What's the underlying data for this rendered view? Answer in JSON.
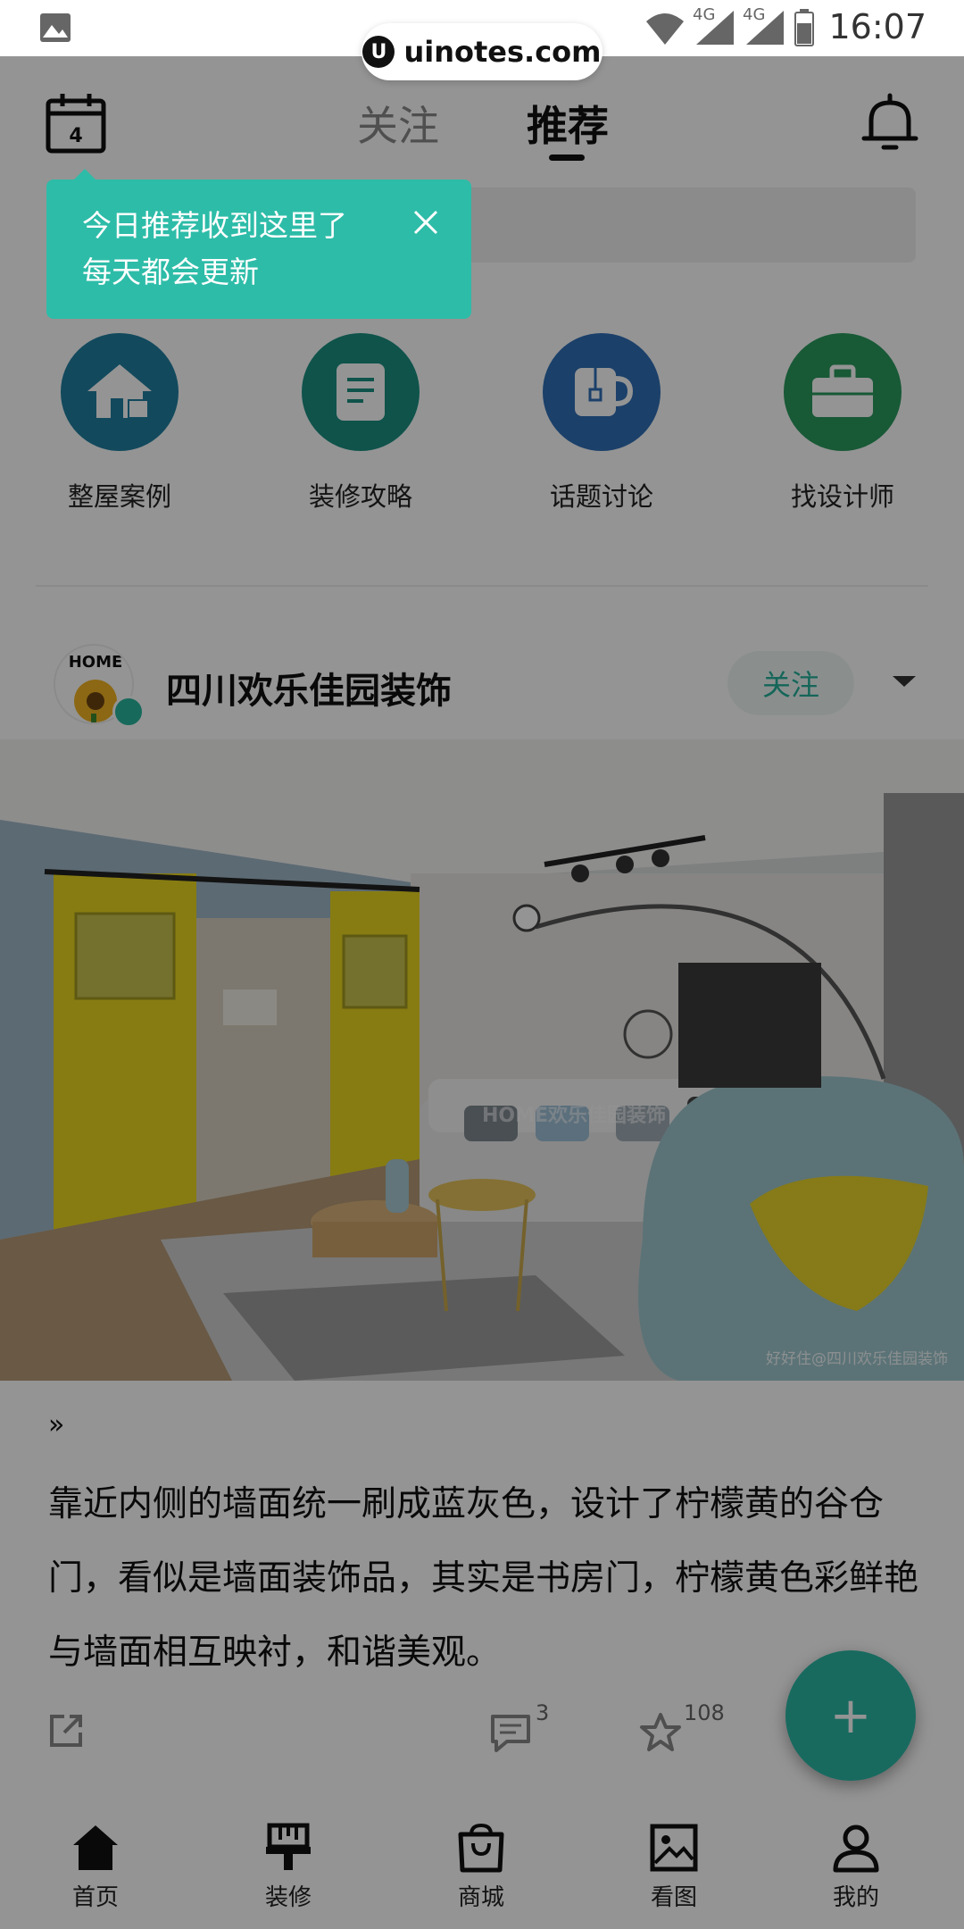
{
  "status_bar": {
    "time": "16:07",
    "network_1": "4G",
    "network_2": "4G"
  },
  "watermark": {
    "text": "uinotes.com"
  },
  "header": {
    "calendar_day": "4",
    "tabs": [
      {
        "label": "关注",
        "active": false
      },
      {
        "label": "推荐",
        "active": true
      }
    ]
  },
  "tooltip": {
    "line1": "今日推荐收到这里了",
    "line2": "每天都会更新"
  },
  "categories": [
    {
      "label": "整屋案例",
      "color": "#1f7fa0",
      "icon": "house-icon"
    },
    {
      "label": "装修攻略",
      "color": "#1a9081",
      "icon": "document-icon"
    },
    {
      "label": "话题讨论",
      "color": "#2f6fb7",
      "icon": "cup-icon"
    },
    {
      "label": "找设计师",
      "color": "#2a9a5e",
      "icon": "briefcase-icon"
    }
  ],
  "post": {
    "author": "四川欢乐佳园装饰",
    "avatar_text": "HOME",
    "follow_label": "关注",
    "photo_credit": "好好住@四川欢乐佳园装饰",
    "photo_watermark": "HOME欢乐佳园装饰",
    "quote_mark": "»",
    "text": "靠近内侧的墙面统一刷成蓝灰色，设计了柠檬黄的谷仓门，看似是墙面装饰品，其实是书房门，柠檬黄色彩鲜艳与墙面相互映衬，和谐美观。",
    "comment_count": "3",
    "star_count": "108"
  },
  "fab": {
    "label": "+"
  },
  "bottom_nav": [
    {
      "label": "首页",
      "icon": "home-icon"
    },
    {
      "label": "装修",
      "icon": "brush-icon"
    },
    {
      "label": "商城",
      "icon": "shopping-bag-icon"
    },
    {
      "label": "看图",
      "icon": "image-icon"
    },
    {
      "label": "我的",
      "icon": "profile-icon"
    }
  ],
  "colors": {
    "accent": "#2dbca8",
    "follow_text": "#25b09a"
  }
}
